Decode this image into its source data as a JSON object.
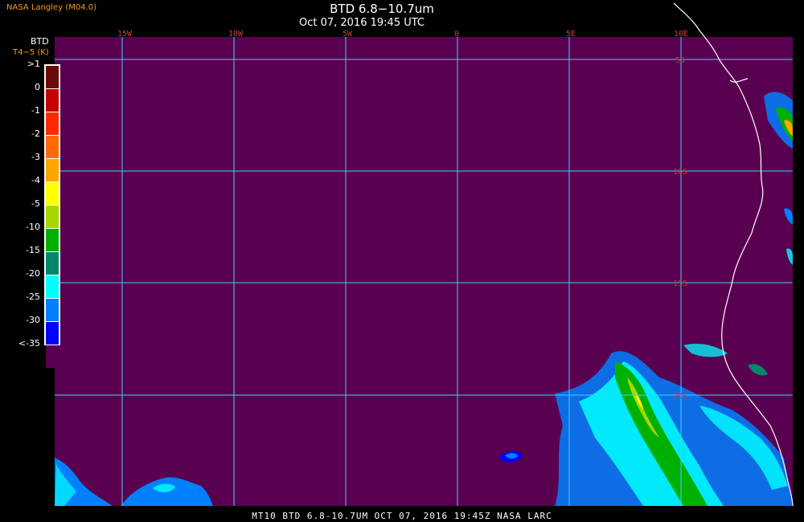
{
  "header": {
    "source": "NASA Langley (M04.0)",
    "title": "BTD 6.8−10.7um",
    "subtitle": "Oct 07, 2016 19:45 UTC"
  },
  "legend": {
    "heading": "BTD",
    "units": "T4−5 (K)",
    "entries": [
      {
        "label": ">1",
        "color": "#6b0a0a"
      },
      {
        "label": "0",
        "color": "#c40000"
      },
      {
        "label": "-1",
        "color": "#ff2a00"
      },
      {
        "label": "-2",
        "color": "#ff6a00"
      },
      {
        "label": "-3",
        "color": "#ffa500"
      },
      {
        "label": "-4",
        "color": "#ffff00"
      },
      {
        "label": "-5",
        "color": "#a6d800"
      },
      {
        "label": "-10",
        "color": "#00b000"
      },
      {
        "label": "-15",
        "color": "#00876a"
      },
      {
        "label": "-20",
        "color": "#00ffff"
      },
      {
        "label": "-25",
        "color": "#0080ff"
      },
      {
        "label": "-30",
        "color": "#0000ff"
      },
      {
        "label": "<-35",
        "color": "#5a0050"
      }
    ]
  },
  "grid": {
    "longitude_labels": [
      "15W",
      "10W",
      "5W",
      "0",
      "5E",
      "10E"
    ],
    "latitude_labels": [
      "5S",
      "10S",
      "15S",
      "20S"
    ],
    "line_color": "#3fd0ff"
  },
  "map": {
    "background_color": "#5a0050",
    "coastline_color": "#ffffff"
  },
  "footer": {
    "caption": "MT10   BTD 6.8-10.7UM   OCT 07, 2016 19:45Z   NASA LARC"
  }
}
